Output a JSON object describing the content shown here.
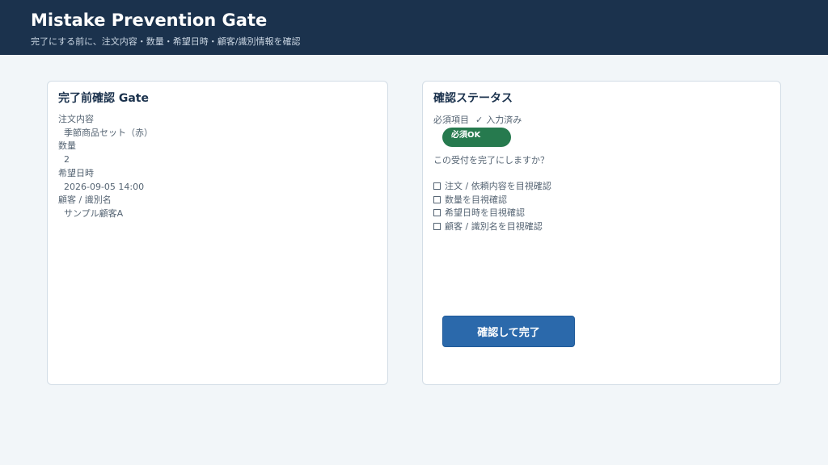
{
  "header": {
    "title": "Mistake Prevention Gate",
    "subtitle": "完了にする前に、注文内容・数量・希望日時・顧客/識別情報を確認"
  },
  "left_card": {
    "title": "完了前確認 Gate",
    "fields": [
      {
        "label": "注文内容",
        "value": "季節商品セット（赤）"
      },
      {
        "label": "数量",
        "value": "2"
      },
      {
        "label": "希望日時",
        "value": "2026-09-05 14:00"
      },
      {
        "label": "顧客 / 識別名",
        "value": "サンプル顧客A"
      }
    ]
  },
  "right_card": {
    "title": "確認ステータス",
    "required_label": "必須項目",
    "required_check": "✓",
    "required_status": "入力済み",
    "badge": "必須OK",
    "question": "この受付を完了にしますか？",
    "checklist": [
      "注文 / 依頼内容を目視確認",
      "数量を目視確認",
      "希望日時を目視確認",
      "顧客 / 識別名を目視確認"
    ],
    "confirm_button": "確認して完了"
  },
  "colors": {
    "header_bg": "#1b324d",
    "badge_green": "#267a4e",
    "button_blue": "#2b69ab"
  },
  "icons": {
    "check": "check-icon",
    "checkbox": "checkbox-icon"
  }
}
